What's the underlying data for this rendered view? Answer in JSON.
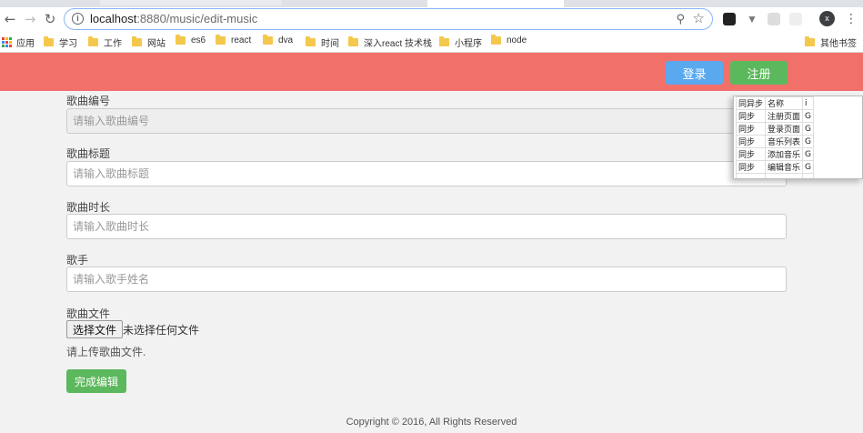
{
  "browser": {
    "url_host": "localhost",
    "url_rest": ":8880/music/edit-music",
    "avatar_letter": "x",
    "bookmarks": [
      {
        "label": "应用",
        "icon": "apps-grid-icon"
      },
      {
        "label": "学习",
        "icon": "folder-icon"
      },
      {
        "label": "工作",
        "icon": "folder-icon"
      },
      {
        "label": "网站",
        "icon": "folder-icon"
      },
      {
        "label": "es6",
        "icon": "folder-icon"
      },
      {
        "label": "react",
        "icon": "folder-icon"
      },
      {
        "label": "dva",
        "icon": "folder-icon"
      },
      {
        "label": "时间",
        "icon": "folder-icon"
      },
      {
        "label": "深入react 技术栈",
        "icon": "folder-icon"
      },
      {
        "label": "小程序",
        "icon": "folder-icon"
      },
      {
        "label": "node",
        "icon": "folder-icon"
      }
    ],
    "other_bookmarks": "其他书签"
  },
  "header": {
    "login_label": "登录",
    "register_label": "注册",
    "colors": {
      "bar": "#f2706a",
      "login": "#5aa9ef",
      "register": "#5cb85c"
    }
  },
  "form": {
    "id_label": "歌曲编号",
    "id_placeholder": "请输入歌曲编号",
    "title_label": "歌曲标题",
    "title_placeholder": "请输入歌曲标题",
    "duration_label": "歌曲时长",
    "duration_placeholder": "请输入歌曲时长",
    "singer_label": "歌手",
    "singer_placeholder": "请输入歌手姓名",
    "file_label": "歌曲文件",
    "file_button": "选择文件",
    "file_status": "未选择任何文件",
    "file_help": "请上传歌曲文件.",
    "submit_label": "完成编辑"
  },
  "footer": {
    "copyright": "Copyright © 2016, All Rights Reserved"
  },
  "route_table": {
    "headers": [
      "同异步",
      "名称",
      "i"
    ],
    "rows": [
      [
        "同步",
        "注册页面",
        "G"
      ],
      [
        "同步",
        "登录页面",
        "G"
      ],
      [
        "同步",
        "音乐列表",
        "G"
      ],
      [
        "同步",
        "添加音乐",
        "G"
      ],
      [
        "同步",
        "编辑音乐",
        "G"
      ]
    ]
  }
}
